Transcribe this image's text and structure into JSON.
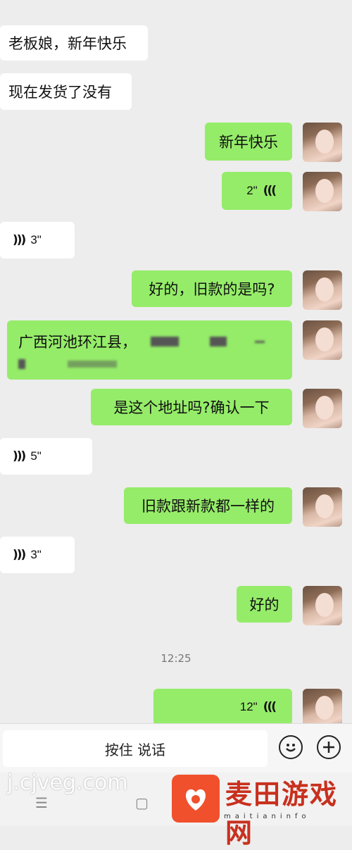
{
  "messages": [
    {
      "side": "left",
      "type": "text",
      "text": "老板娘，新年快乐"
    },
    {
      "side": "left",
      "type": "text",
      "text": "现在发货了没有"
    },
    {
      "side": "right",
      "type": "text",
      "text": "新年快乐"
    },
    {
      "side": "right",
      "type": "voice",
      "duration": "2\""
    },
    {
      "side": "left",
      "type": "voice",
      "duration": "3\""
    },
    {
      "side": "right",
      "type": "text",
      "text": "好的，旧款的是吗?"
    },
    {
      "side": "right",
      "type": "text",
      "text": "广西河池环江县，"
    },
    {
      "side": "right",
      "type": "text",
      "text": "是这个地址吗?确认一下"
    },
    {
      "side": "left",
      "type": "voice",
      "duration": "5\""
    },
    {
      "side": "right",
      "type": "text",
      "text": "旧款跟新款都一样的"
    },
    {
      "side": "left",
      "type": "voice",
      "duration": "3\""
    },
    {
      "side": "right",
      "type": "text",
      "text": "好的"
    },
    {
      "side": "right",
      "type": "voice",
      "duration": "12\""
    }
  ],
  "timestamp": "12:25",
  "input_bar": {
    "hold_to_talk": "按住 说话",
    "emoji_icon": "smile-face",
    "plus_icon": "plus"
  },
  "watermarks": {
    "site": "j.cjveg.com",
    "brand": "麦田游戏网",
    "brand_sub": "maitianinfo"
  },
  "colors": {
    "background": "#ededed",
    "bubble_self": "#95ec69",
    "bubble_other": "#ffffff"
  }
}
